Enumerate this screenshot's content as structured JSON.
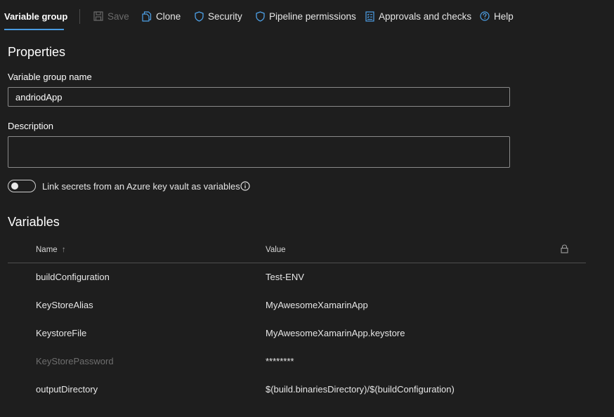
{
  "toolbar": {
    "tab_label": "Variable group",
    "save_label": "Save",
    "clone_label": "Clone",
    "security_label": "Security",
    "pipeline_permissions_label": "Pipeline permissions",
    "approvals_label": "Approvals and checks",
    "help_label": "Help"
  },
  "properties": {
    "title": "Properties",
    "name_label": "Variable group name",
    "name_value": "andriodApp",
    "description_label": "Description",
    "description_value": "",
    "link_secrets_label": "Link secrets from an Azure key vault as variables",
    "link_secrets_enabled": false
  },
  "variables": {
    "title": "Variables",
    "columns": {
      "name": "Name",
      "sort_indicator": "↑",
      "value": "Value"
    },
    "rows": [
      {
        "name": "buildConfiguration",
        "value": "Test-ENV",
        "secret": false
      },
      {
        "name": "KeyStoreAlias",
        "value": "MyAwesomeXamarinApp",
        "secret": false
      },
      {
        "name": "KeystoreFile",
        "value": "MyAwesomeXamarinApp.keystore",
        "secret": false
      },
      {
        "name": "KeyStorePassword",
        "value": "********",
        "secret": true
      },
      {
        "name": "outputDirectory",
        "value": "$(build.binariesDirectory)/$(buildConfiguration)",
        "secret": false
      }
    ]
  },
  "colors": {
    "background": "#1e1e1e",
    "accent": "#4a9be0",
    "icon_blue": "#4ea1e8",
    "disabled": "#6b6b6b"
  },
  "icons": {
    "save": "save-icon",
    "clone": "clone-icon",
    "security": "shield-icon",
    "pipeline_permissions": "shield-icon",
    "approvals": "checklist-icon",
    "help": "help-icon",
    "info": "info-icon",
    "lock": "lock-icon"
  }
}
